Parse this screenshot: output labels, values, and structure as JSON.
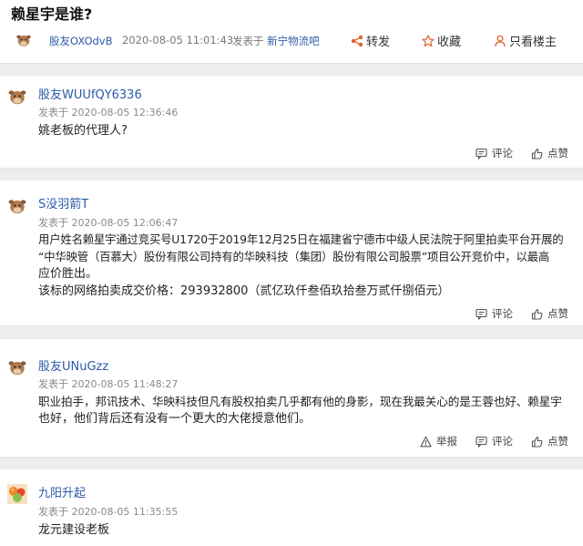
{
  "post": {
    "title": "赖星宇是谁?",
    "author": "股友OXOdvB",
    "time": "2020-08-05 11:01:43",
    "posted_in_prefix": "发表于",
    "board": "新宁物流吧",
    "actions": {
      "share": "转发",
      "favorite": "收藏",
      "owner_only": "只看楼主"
    }
  },
  "comment_actions": {
    "report": "举报",
    "comment": "评论",
    "like": "点赞"
  },
  "comments": [
    {
      "author": "股友WUUfQY6336",
      "posted_prefix": "发表于",
      "time": "2020-08-05 12:36:46",
      "lines": [
        "姚老板的代理人?"
      ]
    },
    {
      "author": "S没羽箭T",
      "posted_prefix": "发表于",
      "time": "2020-08-05 12:06:47",
      "lines": [
        "用户姓名赖星宇通过竞买号U1720于2019年12月25日在福建省宁德市中级人民法院于阿里拍卖平台开展的",
        "“中华映管（百慕大）股份有限公司持有的华映科技（集团）股份有限公司股票”项目公开竞价中，以最高",
        "应价胜出。",
        "该标的网络拍卖成交价格：293932800（贰亿玖仟叁佰玖拾叁万贰仟捌佰元）"
      ]
    },
    {
      "author": "股友UNuGzz",
      "posted_prefix": "发表于",
      "time": "2020-08-05 11:48:27",
      "lines": [
        "职业拍手，邦讯技术、华映科技但凡有股权拍卖几乎都有他的身影，现在我最关心的是王蓉也好、赖星宇",
        "也好，他们背后还有没有一个更大的大佬授意他们。"
      ]
    },
    {
      "author": "九阳升起",
      "posted_prefix": "发表于",
      "time": "2020-08-05 11:35:55",
      "lines": [
        "龙元建设老板"
      ]
    }
  ]
}
